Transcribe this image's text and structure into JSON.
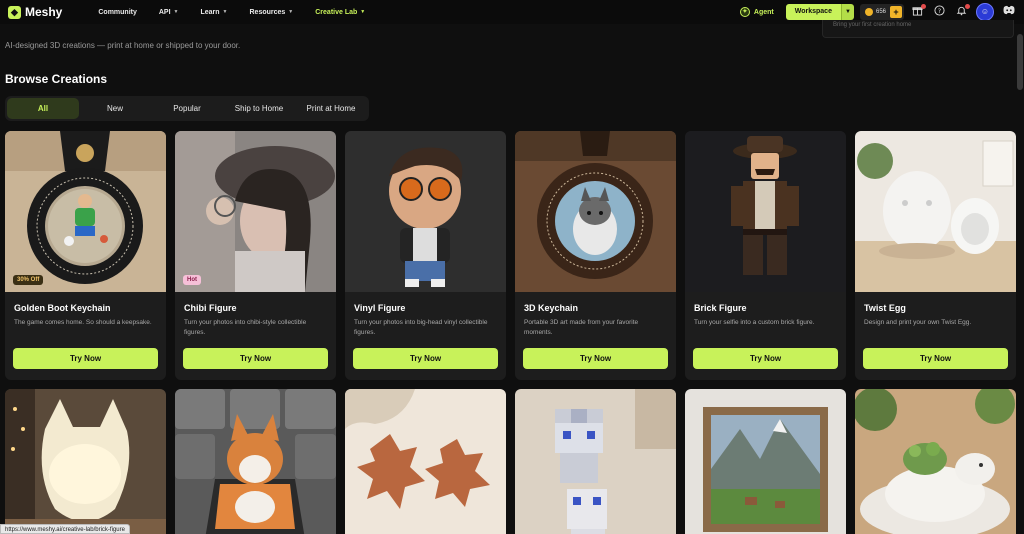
{
  "brand": {
    "name": "Meshy"
  },
  "nav": {
    "items": [
      {
        "label": "Community",
        "caret": false
      },
      {
        "label": "API",
        "caret": true
      },
      {
        "label": "Learn",
        "caret": true
      },
      {
        "label": "Resources",
        "caret": true
      },
      {
        "label": "Creative Lab",
        "caret": true,
        "accent": true
      }
    ]
  },
  "toolbar": {
    "agent_label": "Agent",
    "workspace_label": "Workspace",
    "credits": "656",
    "search_hint": "Bring your first creation home"
  },
  "page": {
    "subtitle": "AI-designed 3D creations — print at home or shipped to your door.",
    "section_title": "Browse Creations"
  },
  "tabs": [
    {
      "label": "All",
      "active": true
    },
    {
      "label": "New"
    },
    {
      "label": "Popular"
    },
    {
      "label": "Ship to Home"
    },
    {
      "label": "Print at Home"
    }
  ],
  "cards": [
    {
      "title": "Golden Boot Keychain",
      "desc": "The game comes home. So should a keepsake.",
      "tag": "30% Off",
      "tagType": "sale",
      "button": "Try Now"
    },
    {
      "title": "Chibi Figure",
      "desc": "Turn your photos into chibi-style collectible figures.",
      "tag": "Hot",
      "tagType": "hot",
      "button": "Try Now"
    },
    {
      "title": "Vinyl Figure",
      "desc": "Turn your photos into big-head vinyl collectible figures.",
      "button": "Try Now"
    },
    {
      "title": "3D Keychain",
      "desc": "Portable 3D art made from your favorite moments.",
      "button": "Try Now"
    },
    {
      "title": "Brick Figure",
      "desc": "Turn your selfie into a custom brick figure.",
      "button": "Try Now"
    },
    {
      "title": "Twist Egg",
      "desc": "Design and print your own Twist Egg.",
      "button": "Try Now"
    }
  ],
  "status_url": "https://www.meshy.ai/creative-lab/brick-figure"
}
